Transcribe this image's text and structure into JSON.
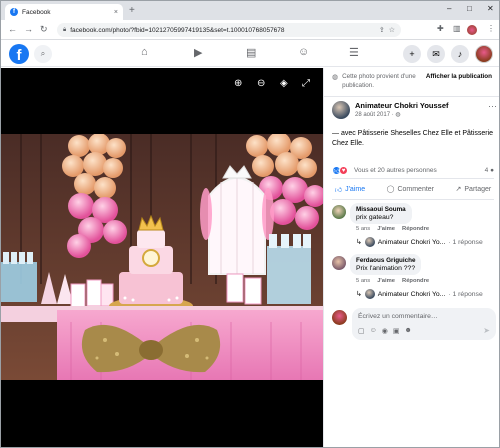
{
  "browser": {
    "tab_title": "Facebook",
    "tab_favicon": "f",
    "url": "facebook.com/photo/?fbid=10212705997419135&set=t.100010768057678",
    "new_tab": "+",
    "close": "×",
    "minimize": "–",
    "maximize": "□",
    "window_close": "✕"
  },
  "fb": {
    "logo": "f",
    "accent": "#1877f2"
  },
  "side": {
    "origin_text": "Cette photo provient d'une publication.",
    "origin_link": "Afficher la publication",
    "author_name": "Animateur Chokri Youssef",
    "post_date": "28 août 2017 · ",
    "more": "···",
    "caption": "— avec Pâtisserie Sheselles Chez Elle et Pâtisserie Chez Elle.",
    "reactions_text": "Vous et 20 autres personnes",
    "comment_count": "4",
    "actions": {
      "like": "J'aime",
      "comment": "Commenter",
      "share": "Partager"
    },
    "comments": [
      {
        "name": "Missaoui Souma",
        "text": "prix gateau?",
        "age": "5 ans",
        "like": "J'aime",
        "reply": "Répondre",
        "reply_author": "Animateur Chokri Yo...",
        "reply_count": "· 1 réponse"
      },
      {
        "name": "Ferdaous Griguiche",
        "text": "Prix l'animation ???",
        "age": "5 ans",
        "like": "J'aime",
        "reply": "Répondre",
        "reply_author": "Animateur Chokri Yo...",
        "reply_count": "· 1 réponse"
      }
    ],
    "write_placeholder": "Écrivez un commentaire…"
  }
}
